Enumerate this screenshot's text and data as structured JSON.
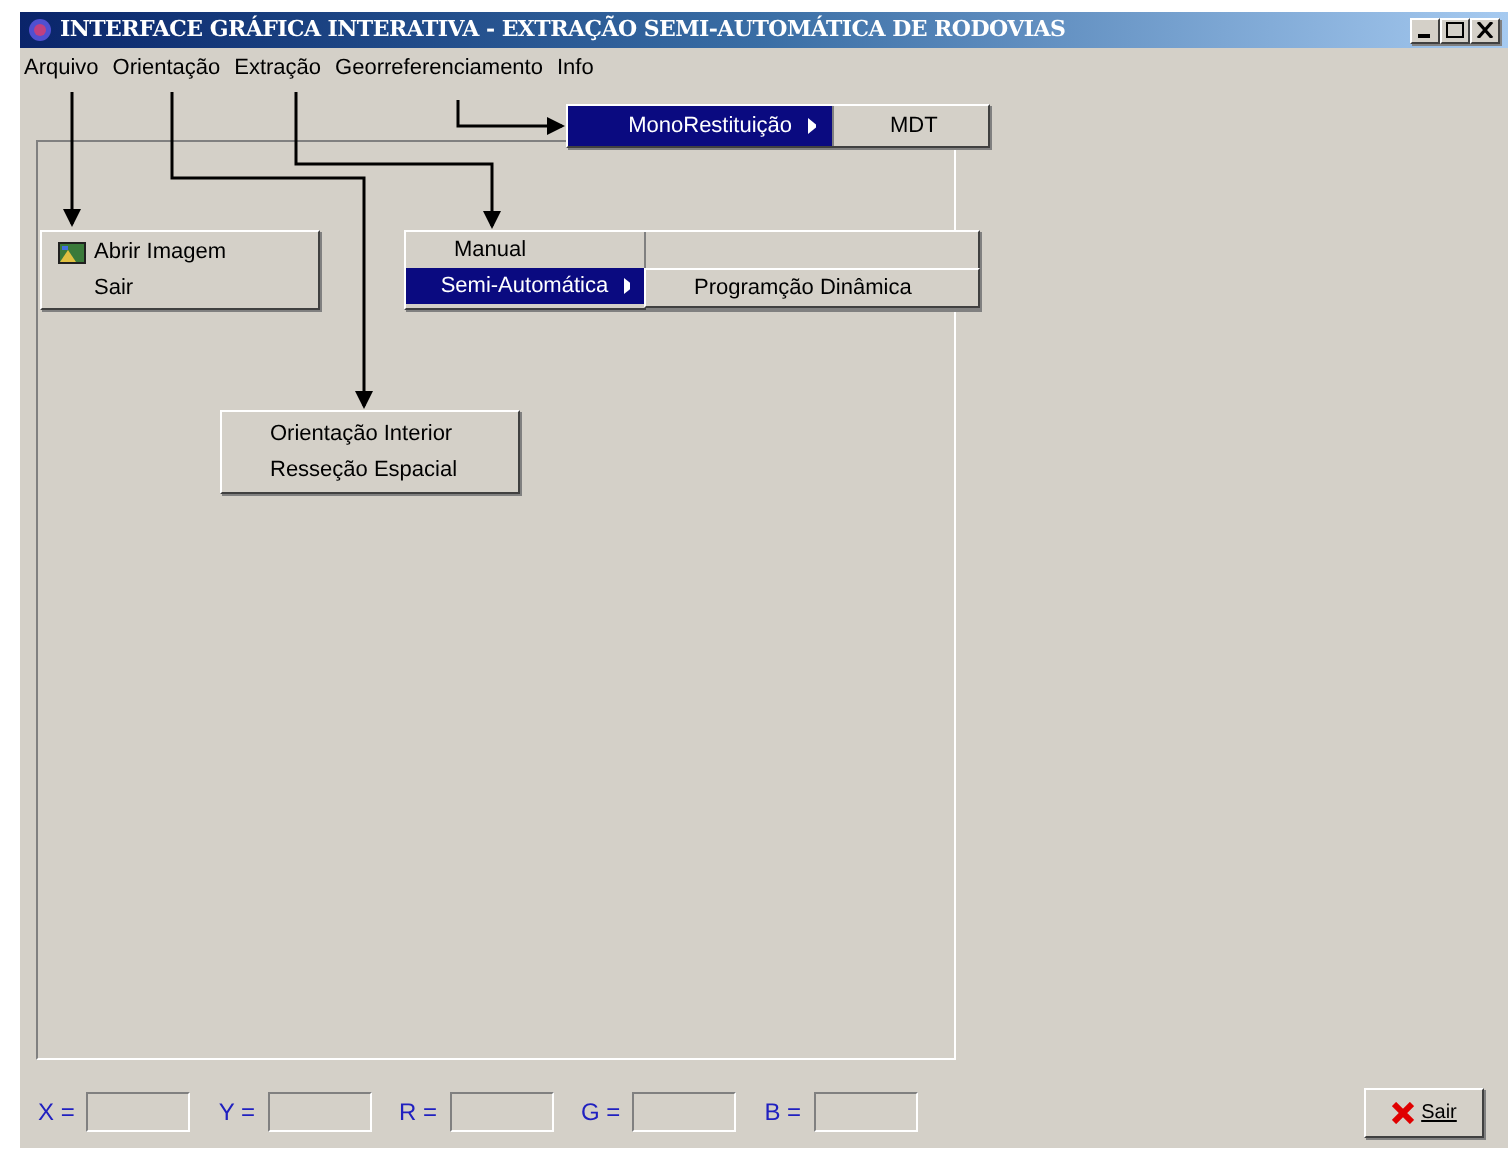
{
  "window": {
    "title": "INTERFACE GRÁFICA INTERATIVA - EXTRAÇÃO SEMI-AUTOMÁTICA DE RODOVIAS"
  },
  "menu_bar": [
    {
      "label": "Arquivo"
    },
    {
      "label": "Orientação"
    },
    {
      "label": "Extração"
    },
    {
      "label": "Georreferenciamento"
    },
    {
      "label": "Info"
    }
  ],
  "menus": {
    "arquivo": [
      {
        "label": "Abrir Imagem",
        "icon": true,
        "selected": false
      },
      {
        "label": "Sair",
        "icon": false,
        "selected": false
      }
    ],
    "extracao": [
      {
        "label": "Manual",
        "submenu": false,
        "selected": false
      },
      {
        "label": "Semi-Automática",
        "submenu": true,
        "selected": true
      }
    ],
    "extracao_submenu": [
      {
        "label": "Programção Dinâmica",
        "selected": false
      }
    ],
    "georreferenciamento": [
      {
        "label": "MonoRestituição",
        "submenu": true,
        "selected": true
      }
    ],
    "georreferenciamento_submenu": [
      {
        "label": "MDT",
        "selected": false
      }
    ],
    "orientacao": [
      {
        "label": "Orientação Interior",
        "selected": false
      },
      {
        "label": "Resseção Espacial",
        "selected": false
      }
    ]
  },
  "coordinates": [
    {
      "label": "X ="
    },
    {
      "label": "Y ="
    },
    {
      "label": "R ="
    },
    {
      "label": "G ="
    },
    {
      "label": "B ="
    }
  ],
  "exit_button": {
    "label": "Sair"
  }
}
